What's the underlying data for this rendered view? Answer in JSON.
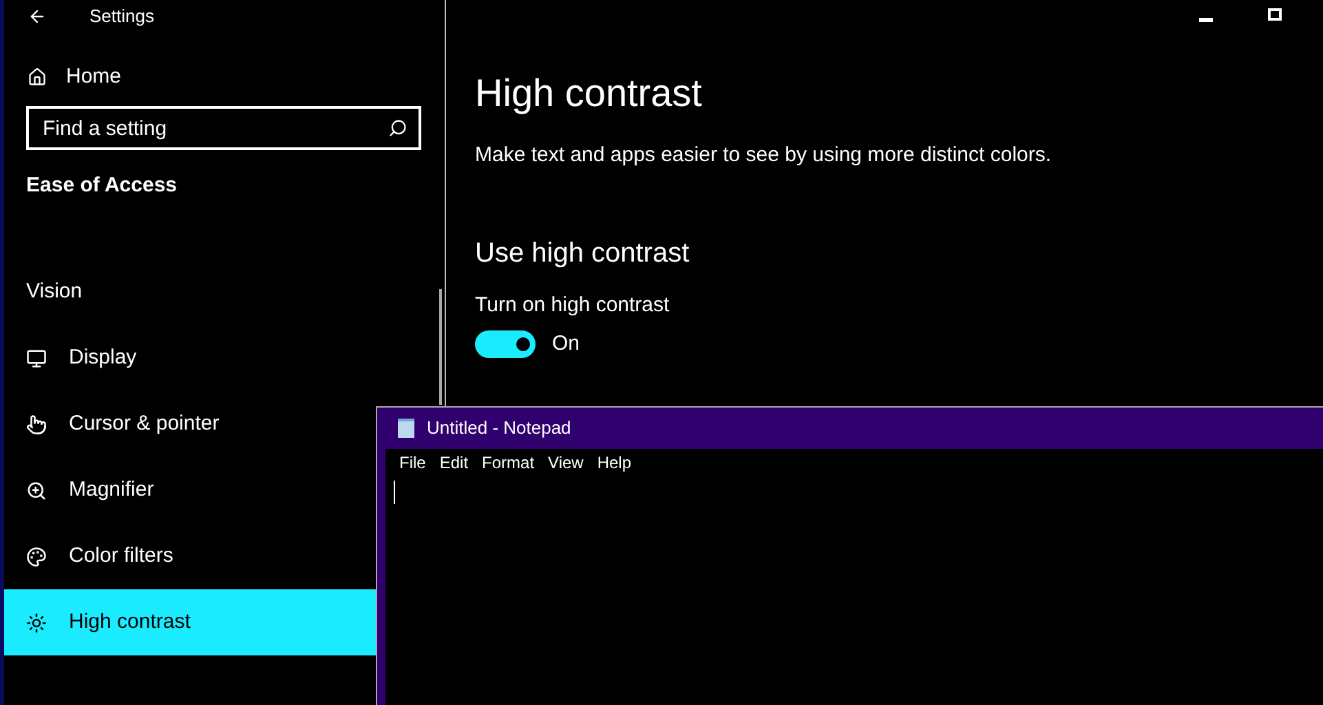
{
  "window": {
    "title": "Settings"
  },
  "sidebar": {
    "home": "Home",
    "search": {
      "placeholder": "Find a setting"
    },
    "category": "Ease of Access",
    "section": "Vision",
    "items": [
      {
        "kind": "display",
        "label": "Display",
        "selected": false
      },
      {
        "kind": "cursor",
        "label": "Cursor & pointer",
        "selected": false
      },
      {
        "kind": "magnifier",
        "label": "Magnifier",
        "selected": false
      },
      {
        "kind": "palette",
        "label": "Color filters",
        "selected": false
      },
      {
        "kind": "sun",
        "label": "High contrast",
        "selected": true
      }
    ]
  },
  "content": {
    "title": "High contrast",
    "description": "Make text and apps easier to see by using more distinct colors.",
    "heading": "Use high contrast",
    "toggle": {
      "label": "Turn on high contrast",
      "on": true,
      "state_text": "On"
    }
  },
  "notepad": {
    "title": "Untitled - Notepad",
    "menu": [
      "File",
      "Edit",
      "Format",
      "View",
      "Help"
    ]
  }
}
